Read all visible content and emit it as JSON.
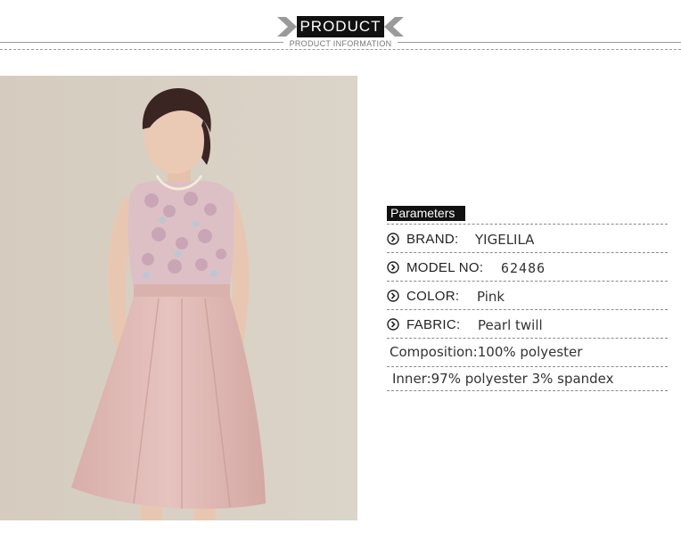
{
  "header": {
    "title": "PRODUCT",
    "subtitle": "PRODUCT INFORMATION"
  },
  "photo": {
    "background_color": "#d7cfc2",
    "dress_color": "#e2bcb8"
  },
  "parameters": {
    "heading": "Parameters",
    "brand": {
      "label": "BRAND:",
      "value": "YIGELILA"
    },
    "model": {
      "label": "MODEL NO:",
      "value": "62486"
    },
    "color": {
      "label": "COLOR:",
      "value": "Pink"
    },
    "fabric": {
      "label": "FABRIC:",
      "value": "Pearl twill"
    },
    "composition": "Composition:100% polyester",
    "inner": "Inner:97% polyester 3% spandex"
  },
  "icons": {
    "bullet": "circle-chevron-right-icon"
  }
}
